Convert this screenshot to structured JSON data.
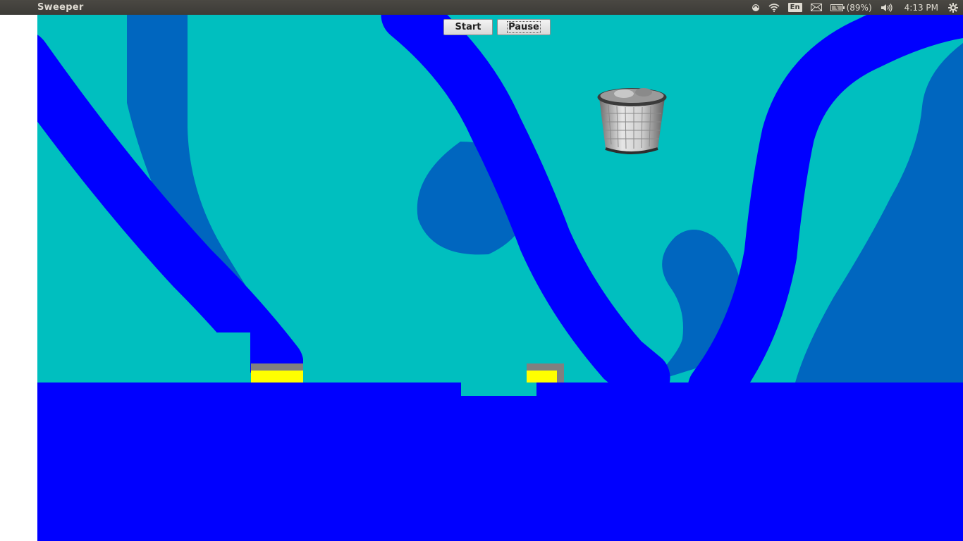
{
  "window": {
    "title": "Sweeper"
  },
  "panel": {
    "language": "En",
    "battery": "(89%)",
    "clock": "4:13 PM",
    "icons": [
      "network-icon",
      "wifi-icon",
      "keyboard-layout-icon",
      "mail-icon",
      "battery-icon",
      "volume-icon",
      "gear-icon"
    ]
  },
  "toolbar": {
    "start_label": "Start",
    "pause_label": "Pause"
  },
  "game": {
    "colors": {
      "water": "#00bfbf",
      "shadow": "#0066bf",
      "stream": "#0000ff",
      "ledge": "#808080",
      "marker": "#ffff00"
    },
    "objects": [
      "trash-can",
      "yellow-marker-left",
      "yellow-marker-right"
    ]
  }
}
